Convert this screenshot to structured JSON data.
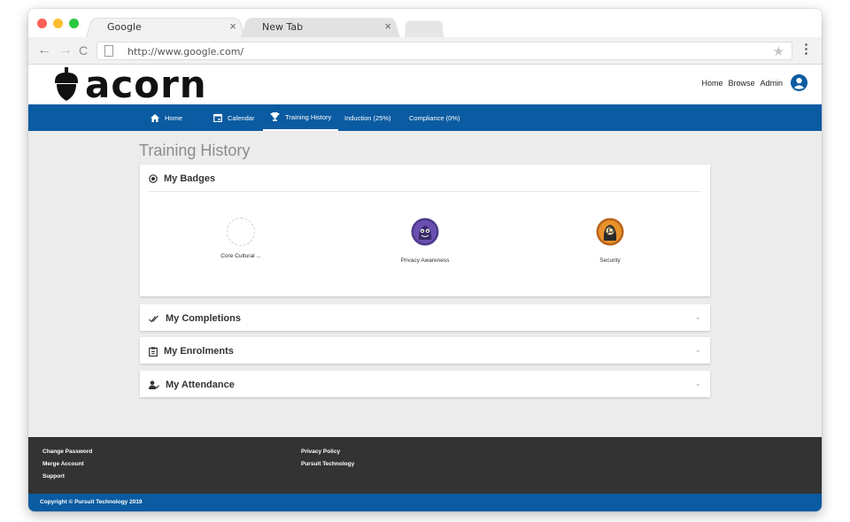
{
  "browser": {
    "tabs": [
      {
        "title": "Google",
        "close": "×"
      },
      {
        "title": "New Tab",
        "close": "×"
      }
    ],
    "url": "http://www.google.com/",
    "back": "←",
    "forward": "→",
    "reload": "C",
    "star": "★",
    "menu": "⋮"
  },
  "site": {
    "logo_text": "acorn",
    "header_links": [
      "Home",
      "Browse",
      "Admin"
    ],
    "nav": [
      {
        "label": "Home",
        "icon": "home-icon"
      },
      {
        "label": "Calendar",
        "icon": "calendar-icon"
      },
      {
        "label": "Training History",
        "icon": "trophy-icon"
      },
      {
        "label": "Induction (25%)",
        "icon": ""
      },
      {
        "label": "Compliance (0%)",
        "icon": ""
      }
    ]
  },
  "page": {
    "title": "Training History",
    "badges_card": {
      "title": "My Badges",
      "badges": [
        {
          "label": "Core Cultural ...",
          "icon": "empty-badge-icon"
        },
        {
          "label": "Privacy Awareness",
          "icon": "privacy-monster-badge-icon",
          "color": "#5b3d8c"
        },
        {
          "label": "Security",
          "icon": "security-badge-icon",
          "color": "#e07b1e"
        }
      ]
    },
    "sections": [
      {
        "title": "My Completions",
        "icon": "double-check-icon",
        "chevron": "⌄"
      },
      {
        "title": "My Enrolments",
        "icon": "clipboard-icon",
        "chevron": "⌄"
      },
      {
        "title": "My Attendance",
        "icon": "person-check-icon",
        "chevron": "⌄"
      }
    ]
  },
  "footer": {
    "col1": [
      "Change Password",
      "Merge Account",
      "Support"
    ],
    "col2": [
      "Privacy Policy",
      "Pursuit Technology"
    ],
    "copyright": "Copyright © Pursuit Technology 2019"
  },
  "colors": {
    "brand_blue": "#0a5ba1",
    "footer_dark": "#333333",
    "content_bg": "#ececec"
  }
}
